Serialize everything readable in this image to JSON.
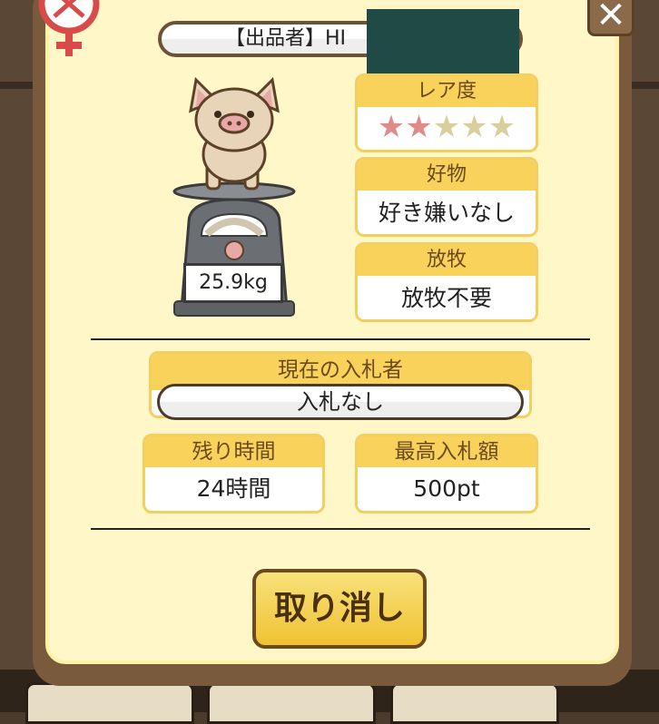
{
  "header": {
    "seller_label": "【出品者】HI"
  },
  "close_icon": "close-icon",
  "pig": {
    "weight": "25.9kg"
  },
  "rarity": {
    "label": "レア度",
    "stars_filled": 2,
    "stars_total": 5,
    "colors": {
      "filled": "#e08a8a",
      "empty": "#d9cf9d"
    }
  },
  "likes": {
    "label": "好物",
    "value": "好き嫌いなし"
  },
  "grazing": {
    "label": "放牧",
    "value": "放牧不要"
  },
  "current_bidder": {
    "label": "現在の入札者",
    "value": "入札なし"
  },
  "remaining_time": {
    "label": "残り時間",
    "value": "24時間"
  },
  "highest_bid": {
    "label": "最高入札額",
    "value": "500pt"
  },
  "cancel_button": {
    "label": "取り消し"
  },
  "colors": {
    "panel_bg": "#fff7c8",
    "header_yellow": "#f8d25a",
    "border_brown": "#7a5a3c"
  }
}
